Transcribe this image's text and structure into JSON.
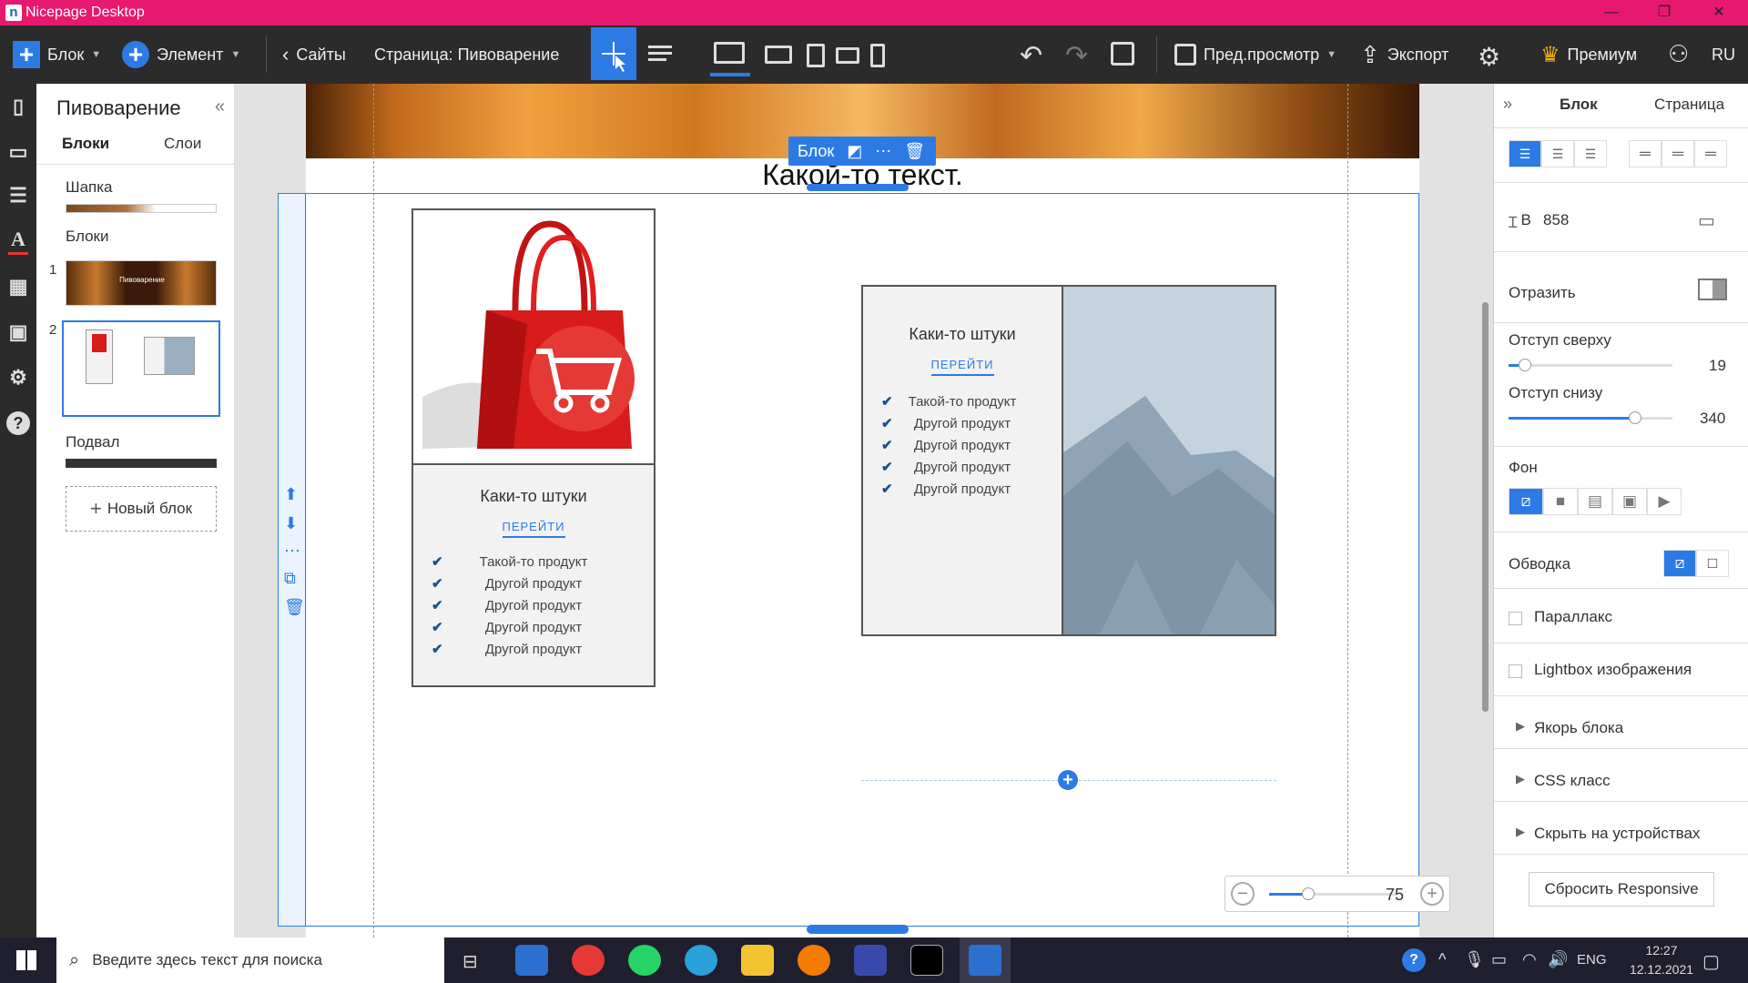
{
  "window": {
    "title": "Nicepage Desktop",
    "minimize": "—",
    "restore": "❐",
    "close": "✕"
  },
  "toolbar": {
    "block_label": "Блок",
    "element_label": "Элемент",
    "sites_label": "Сайты",
    "page_label": "Страница: Пивоварение",
    "preview_label": "Пред.просмотр",
    "export_label": "Экспорт",
    "premium_label": "Премиум",
    "lang": "RU"
  },
  "left_panel": {
    "title": "Пивоварение",
    "tab_blocks": "Блоки",
    "tab_layers": "Слои",
    "header_label": "Шапка",
    "blocks_label": "Блоки",
    "item1_num": "1",
    "item1_text": "Пивоварение",
    "item2_num": "2",
    "footer_label": "Подвал",
    "new_block": "Новый блок"
  },
  "canvas": {
    "heading": "Какой-то текст.",
    "block_toolbar_label": "Блок",
    "zoom_value": "75",
    "card1": {
      "title": "Каки-то штуки",
      "link": "ПЕРЕЙТИ",
      "items": [
        "Такой-то продукт",
        "Другой продукт",
        "Другой продукт",
        "Другой продукт",
        "Другой продукт"
      ]
    },
    "card2": {
      "title": "Каки-то штуки",
      "link": "ПЕРЕЙТИ",
      "items": [
        "Такой-то продукт",
        "Другой продукт",
        "Другой продукт",
        "Другой продукт",
        "Другой продукт"
      ]
    }
  },
  "right_panel": {
    "tab_block": "Блок",
    "tab_page": "Страница",
    "height_label": "В",
    "height_value": "858",
    "mirror_label": "Отразить",
    "pad_top_label": "Отступ сверху",
    "pad_top_value": "19",
    "pad_top_level": 0.1,
    "pad_bottom_label": "Отступ снизу",
    "pad_bottom_value": "340",
    "pad_bottom_level": 0.77,
    "bg_label": "Фон",
    "border_label": "Обводка",
    "parallax_label": "Параллакс",
    "lightbox_label": "Lightbox изображения",
    "anchor_label": "Якорь блока",
    "css_label": "CSS класс",
    "hide_label": "Скрыть на устройствах",
    "reset_button": "Сбросить Responsive"
  },
  "taskbar": {
    "search_placeholder": "Введите здесь текст для поиска",
    "lang": "ENG",
    "time": "12:27",
    "date": "12.12.2021"
  },
  "colors": {
    "accent": "#2c7be5",
    "titlebar": "#e6196e",
    "bag": "#d81b1b"
  }
}
